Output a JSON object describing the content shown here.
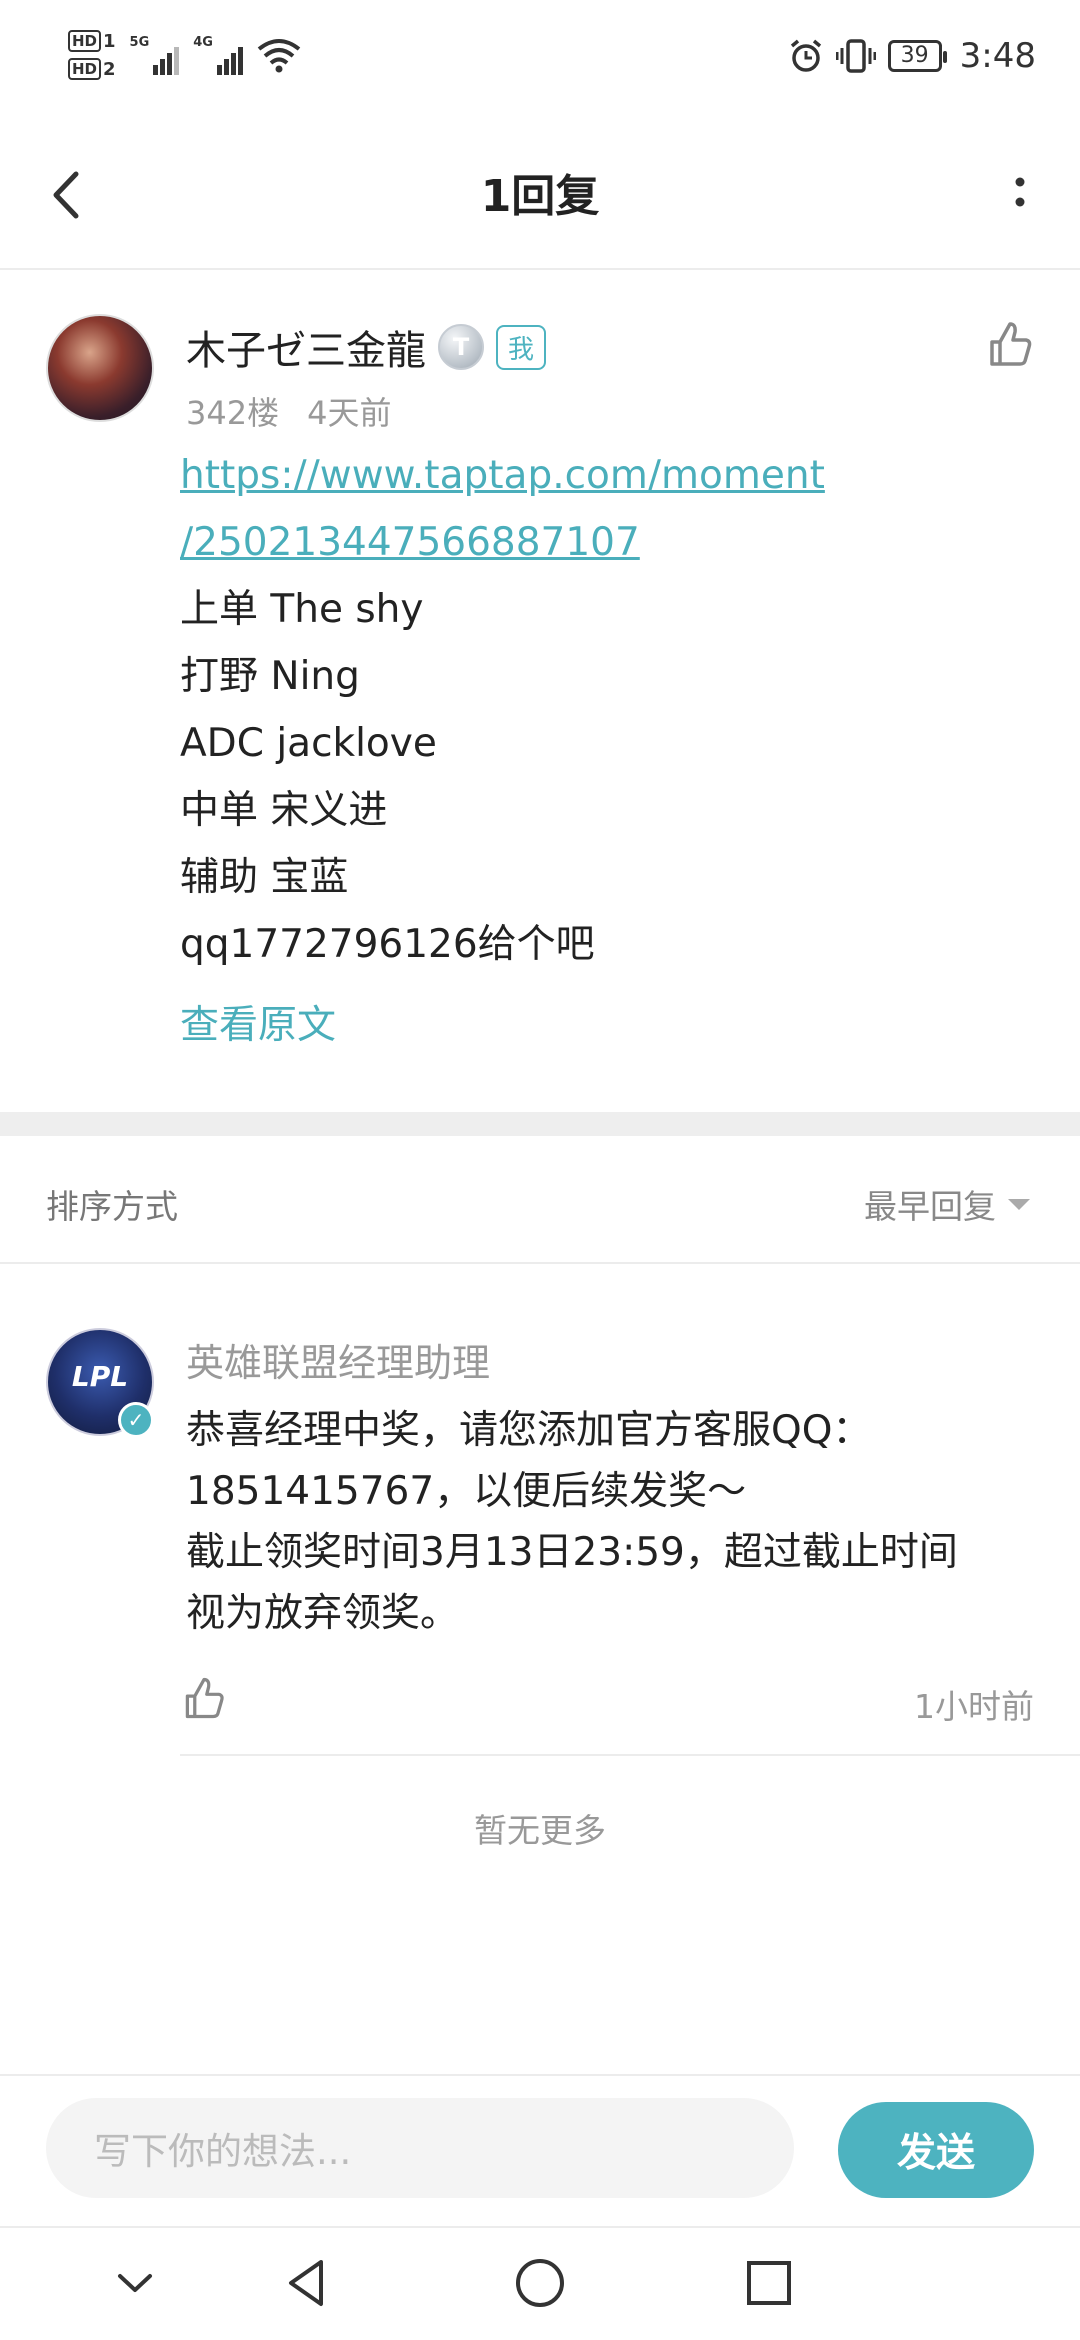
{
  "status_bar": {
    "hd1": "HD",
    "hd1_sub": "1",
    "hd2": "HD",
    "hd2_sub": "2",
    "net1": "5G",
    "net2": "4G",
    "battery": "39",
    "time": "3:48",
    "icons": [
      "alarm-icon",
      "vibrate-icon",
      "wifi-icon",
      "signal-icon",
      "battery-icon"
    ]
  },
  "header": {
    "title": "1回复",
    "back_icon": "chevron-left-icon",
    "more_icon": "more-vertical-icon"
  },
  "post": {
    "author": "木子ゼ三金龍",
    "level_badge": "T",
    "me_badge": "我",
    "floor": "342楼",
    "time": "4天前",
    "link_line1": "https://www.taptap.com/moment",
    "link_line2": "/250213447566887107",
    "lines": [
      "上单 The shy",
      "打野 Ning",
      "ADC jacklove",
      "中单 宋义进",
      "辅助 宝蓝",
      "qq1772796126给个吧"
    ],
    "view_original": "查看原文"
  },
  "sort": {
    "label": "排序方式",
    "value": "最早回复"
  },
  "reply": {
    "author": "英雄联盟经理助理",
    "avatar_text": "LPL",
    "text_lines": [
      "恭喜经理中奖，请您添加官方客服QQ：",
      "1851415767，以便后续发奖～",
      "截止领奖时间3月13日23:59，超过截止时间",
      "视为放弃领奖。"
    ],
    "time": "1小时前"
  },
  "no_more": "暂无更多",
  "composer": {
    "placeholder": "写下你的想法...",
    "send": "发送"
  },
  "colors": {
    "accent": "#4db3c0",
    "link": "#4aaebb",
    "muted": "#999999"
  }
}
